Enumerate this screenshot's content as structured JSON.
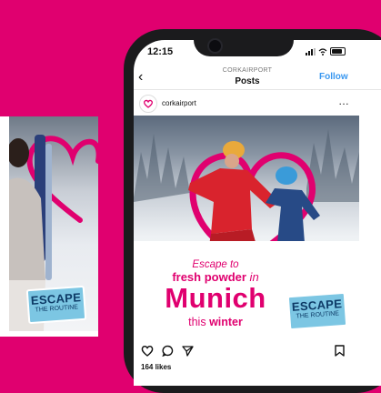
{
  "status_bar": {
    "time": "12:15"
  },
  "header": {
    "account": "CORKAIRPORT",
    "title": "Posts",
    "follow_label": "Follow",
    "back_icon": "chevron-left-icon"
  },
  "post_author": {
    "name": "corkairport",
    "more_icon": "more-dots-icon"
  },
  "post_image": {
    "line1": "Escape to",
    "line2_bold": "fresh powder",
    "line2_tail": " in",
    "line3": "Munich",
    "line4_plain": "this ",
    "line4_bold": "winter",
    "badge_big": "ESCAPE",
    "badge_small": "THE ROUTINE"
  },
  "side_card": {
    "badge_big": "ESCAPE",
    "badge_small": "THE ROUTINE"
  },
  "actions": {
    "icons": [
      "heart-icon",
      "comment-icon",
      "share-icon",
      "bookmark-icon"
    ]
  },
  "likes": "164 likes",
  "colors": {
    "brand": "#e0006f",
    "badge": "#7cc6e3",
    "follow": "#3897f0"
  }
}
